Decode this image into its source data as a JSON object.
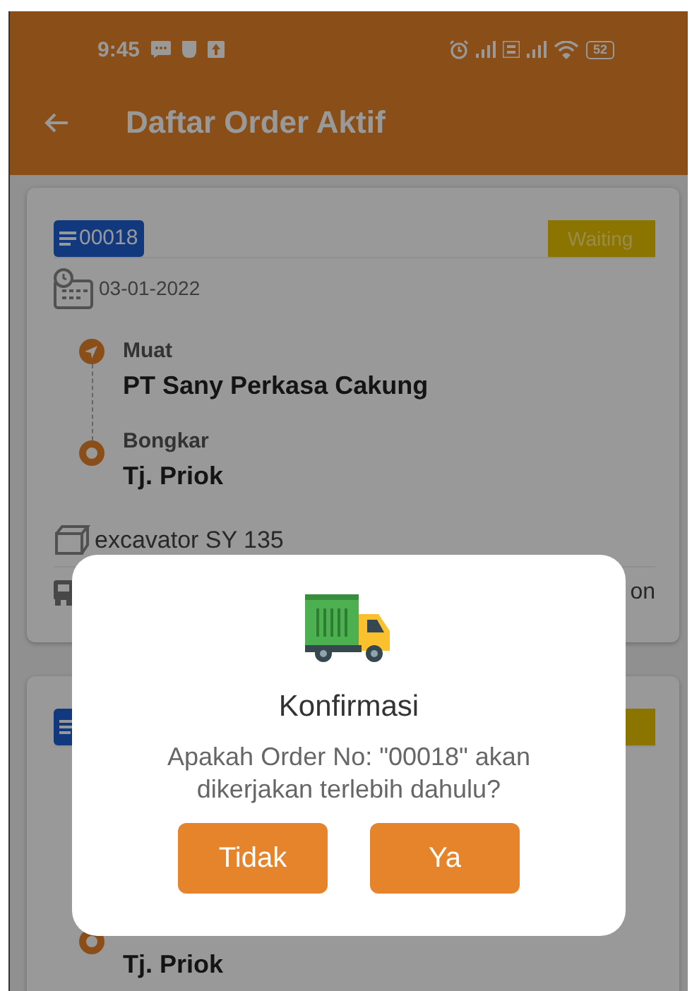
{
  "status_bar": {
    "time": "9:45",
    "battery": "52"
  },
  "app_bar": {
    "title": "Daftar Order Aktif"
  },
  "orders": [
    {
      "order_no": "00018",
      "status": "Waiting",
      "date": "03-01-2022",
      "pickup_label": "Muat",
      "pickup": "PT Sany Perkasa Cakung",
      "dropoff_label": "Bongkar",
      "dropoff": "Tj. Priok",
      "cargo": "excavator  SY 135",
      "vehicle": "on"
    },
    {
      "dropoff": "Tj. Priok"
    }
  ],
  "dialog": {
    "title": "Konfirmasi",
    "message": "Apakah Order No: \"00018\" akan dikerjakan terlebih dahulu?",
    "buttons": [
      "Tidak",
      "Ya"
    ]
  }
}
